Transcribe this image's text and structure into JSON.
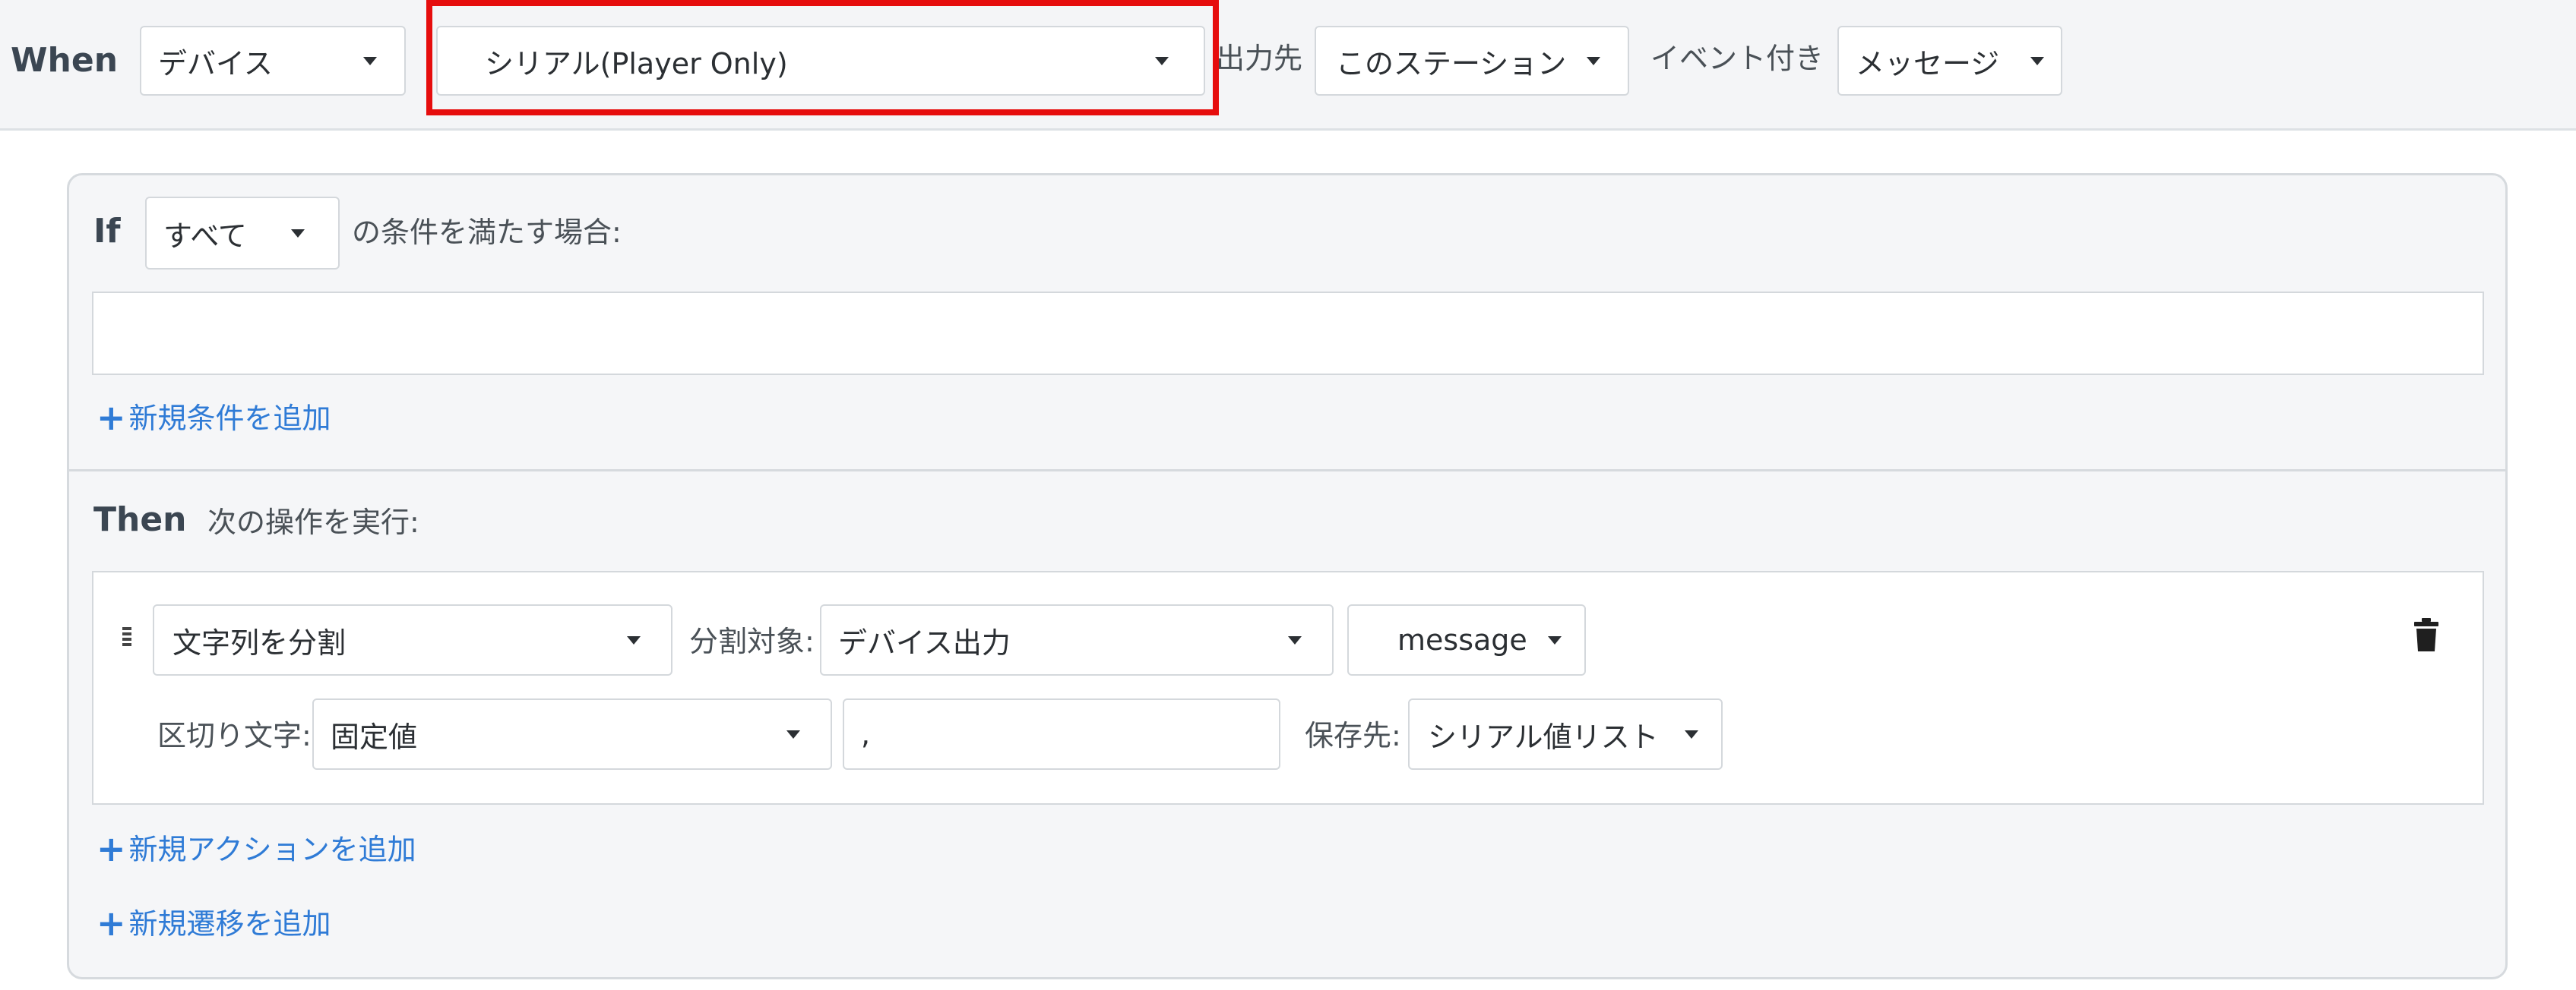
{
  "when": {
    "keyword": "When",
    "device_select": "デバイス",
    "device_type_select": "シリアル(Player Only)",
    "output_to_label": "出力先",
    "output_to_select": "このステーション",
    "event_label": "イベント付き",
    "event_select": "メッセージ"
  },
  "if": {
    "keyword": "If",
    "match_select": "すべて",
    "match_suffix": "の条件を満たす場合:",
    "add_condition": "新規条件を追加"
  },
  "then": {
    "keyword": "Then",
    "description": "次の操作を実行:",
    "action": {
      "type_select": "文字列を分割",
      "target_label": "分割対象:",
      "target_select": "デバイス出力",
      "field_select": "message",
      "delimiter_label": "区切り文字:",
      "delimiter_mode_select": "固定値",
      "delimiter_value": ",",
      "save_label": "保存先:",
      "save_select": "シリアル値リスト"
    },
    "add_action": "新規アクションを追加",
    "add_transition": "新規遷移を追加"
  },
  "colors": {
    "highlight": "#e60d0d",
    "link": "#2f7bd6",
    "panel_bg": "#f4f5f7"
  }
}
